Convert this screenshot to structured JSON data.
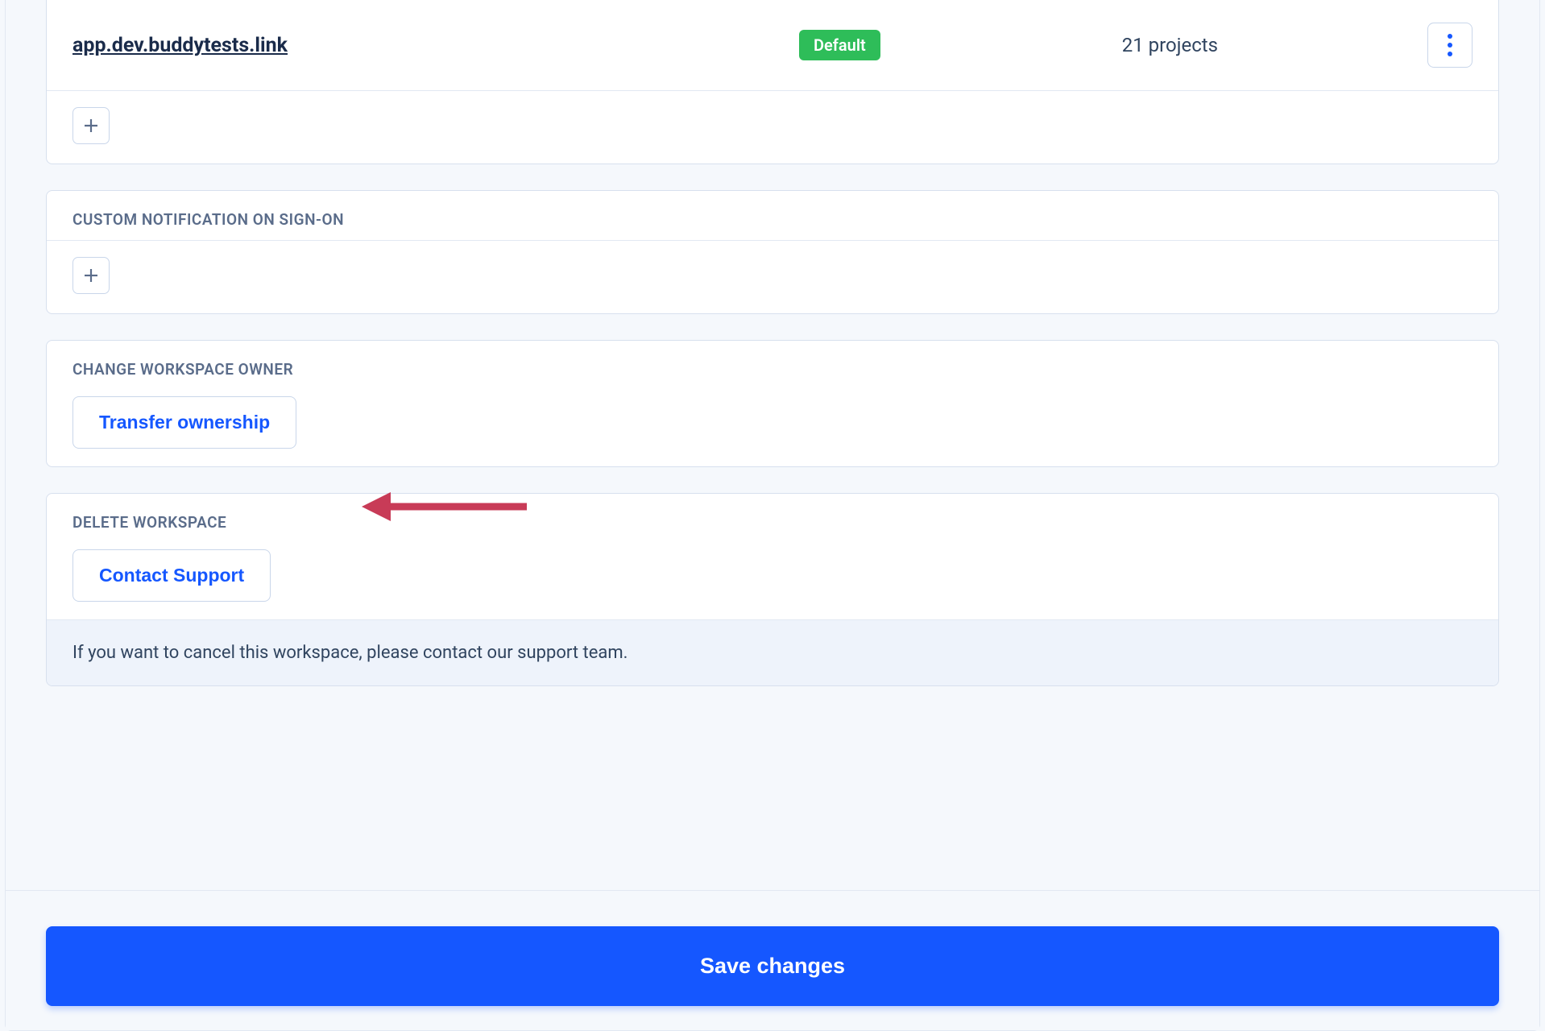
{
  "domains": {
    "row": {
      "link": "app.dev.buddytests.link",
      "badge": "Default",
      "projects_text": "21 projects"
    }
  },
  "sections": {
    "custom_notification": {
      "title": "CUSTOM NOTIFICATION ON SIGN-ON"
    },
    "change_owner": {
      "title": "CHANGE WORKSPACE OWNER",
      "button": "Transfer ownership"
    },
    "delete_workspace": {
      "title": "DELETE WORKSPACE",
      "button": "Contact Support",
      "info": "If you want to cancel this workspace, please contact our support team."
    }
  },
  "footer": {
    "save": "Save changes"
  }
}
